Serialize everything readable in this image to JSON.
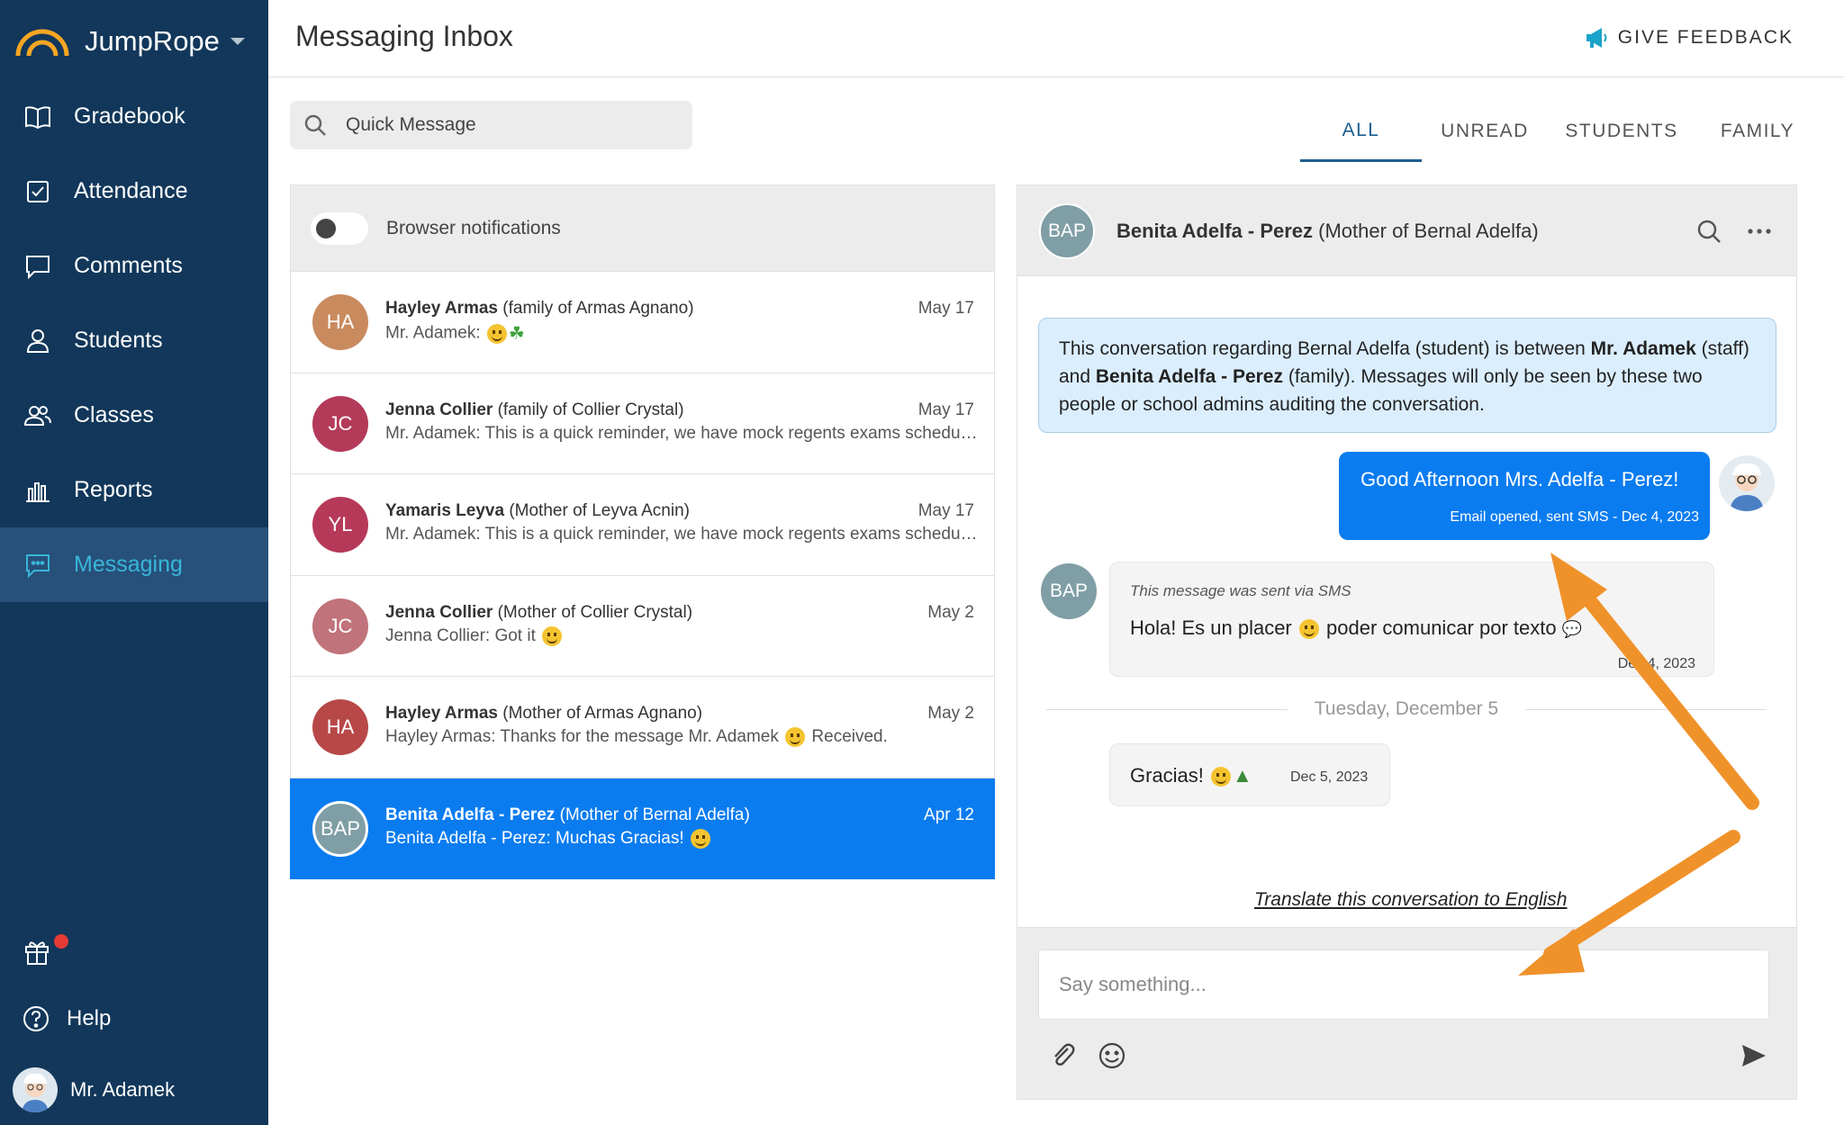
{
  "brand": {
    "name": "JumpRope"
  },
  "sidebar": {
    "items": [
      {
        "label": "Gradebook",
        "icon": "book-icon"
      },
      {
        "label": "Attendance",
        "icon": "checkbox-icon"
      },
      {
        "label": "Comments",
        "icon": "comment-icon"
      },
      {
        "label": "Students",
        "icon": "person-icon"
      },
      {
        "label": "Classes",
        "icon": "people-icon"
      },
      {
        "label": "Reports",
        "icon": "bar-chart-icon"
      },
      {
        "label": "Messaging",
        "icon": "message-icon",
        "active": true
      }
    ],
    "help_label": "Help",
    "user_name": "Mr. Adamek"
  },
  "header": {
    "title": "Messaging Inbox",
    "feedback_label": "GIVE FEEDBACK"
  },
  "search": {
    "placeholder": "Quick Message"
  },
  "tabs": [
    {
      "label": "ALL",
      "active": true
    },
    {
      "label": "UNREAD"
    },
    {
      "label": "STUDENTS"
    },
    {
      "label": "FAMILY"
    }
  ],
  "notifications": {
    "label": "Browser notifications",
    "enabled": false
  },
  "conversations": [
    {
      "initials": "HA",
      "color": "#c98a5e",
      "name": "Hayley Armas",
      "relation": "(family of Armas Agnano)",
      "date": "May 17",
      "preview": "Mr. Adamek:"
    },
    {
      "initials": "JC",
      "color": "#b43a5a",
      "name": "Jenna Collier",
      "relation": "(family of Collier Crystal)",
      "date": "May 17",
      "preview": "Mr. Adamek: This is a quick reminder, we have mock regents exams scheduled ..."
    },
    {
      "initials": "YL",
      "color": "#b7395a",
      "name": "Yamaris Leyva",
      "relation": "(Mother of Leyva Acnin)",
      "date": "May 17",
      "preview": "Mr. Adamek: This is a quick reminder, we have mock regents exams scheduled ..."
    },
    {
      "initials": "JC",
      "color": "#c0737a",
      "name": "Jenna Collier",
      "relation": "(Mother of Collier Crystal)",
      "date": "May 2",
      "preview": "Jenna Collier: Got it"
    },
    {
      "initials": "HA",
      "color": "#b84848",
      "name": "Hayley Armas",
      "relation": "(Mother of Armas Agnano)",
      "date": "May 2",
      "preview": "Hayley Armas: Thanks for the message Mr. Adamek",
      "preview_tail": "Received."
    },
    {
      "initials": "BAP",
      "color": "#7f9ea5",
      "name": "Benita Adelfa - Perez",
      "relation": "(Mother of Bernal Adelfa)",
      "date": "Apr 12",
      "preview": "Benita Adelfa - Perez: Muchas Gracias!",
      "selected": true
    }
  ],
  "chat": {
    "initials": "BAP",
    "name": "Benita Adelfa - Perez",
    "relation": "(Mother of Bernal Adelfa)",
    "banner": {
      "p1": "This conversation regarding Bernal Adelfa (student) is between ",
      "staff": "Mr. Adamek",
      "p2": " (staff) and ",
      "family": "Benita Adelfa - Perez",
      "p3": " (family). Messages will only be seen by these two people or school admins auditing the conversation."
    },
    "outgoing": {
      "text": "Good Afternoon Mrs. Adelfa - Perez!",
      "meta": "Email opened, sent SMS - Dec 4, 2023"
    },
    "incoming1": {
      "via": "This message was sent via SMS",
      "text_a": "Hola! Es un placer",
      "text_b": "poder comunicar por texto",
      "meta": "Dec 4, 2023"
    },
    "day_separator": "Tuesday, December 5",
    "incoming2": {
      "text": "Gracias!",
      "meta": "Dec 5, 2023"
    },
    "translate_label": "Translate this conversation to English",
    "composer_placeholder": "Say something..."
  },
  "colors": {
    "sidebar": "#12375a",
    "active_nav": "#38b6d9",
    "primary": "#0a7cf0",
    "annotation_arrow": "#f0922a"
  }
}
